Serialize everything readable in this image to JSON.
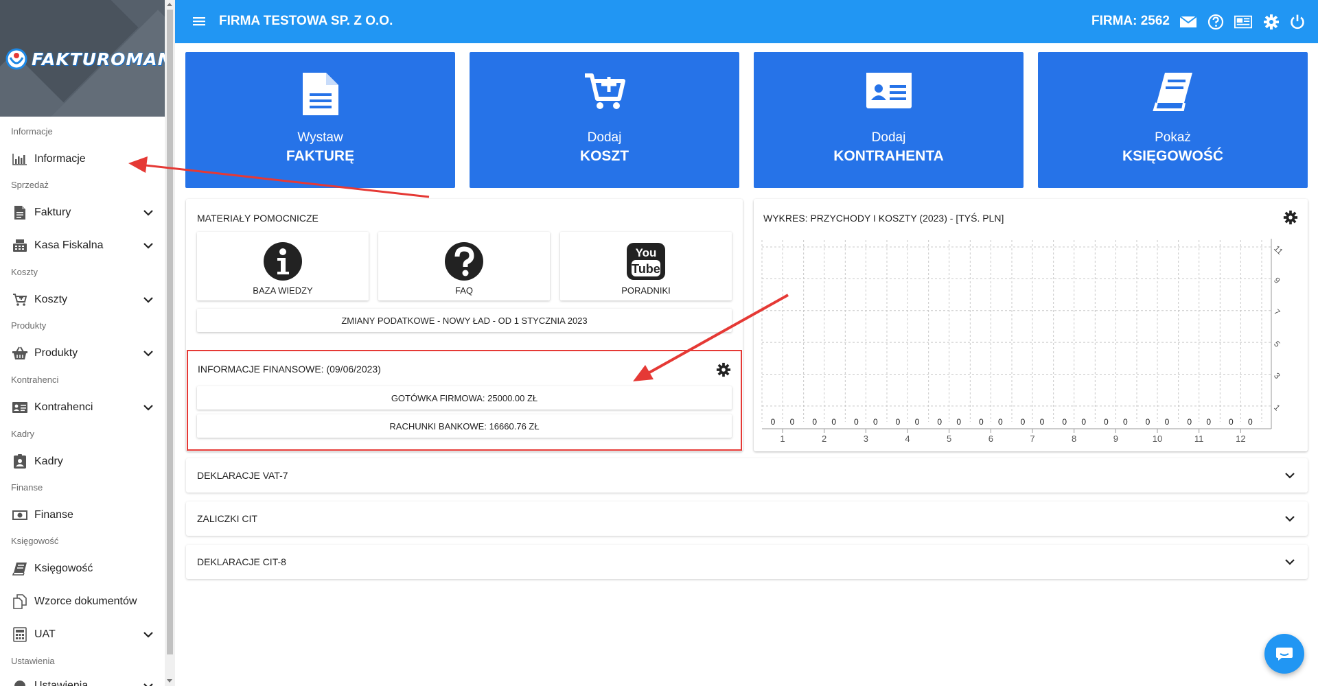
{
  "sidebar": {
    "logo_text": "FAKTUROMANIA",
    "sections": {
      "informacje": "Informacje",
      "sprzedaz": "Sprzedaż",
      "koszty": "Koszty",
      "produkty": "Produkty",
      "kontrahenci": "Kontrahenci",
      "kadry": "Kadry",
      "finanse": "Finanse",
      "ksiegowosc": "Księgowość",
      "ustawienia": "Ustawienia"
    },
    "items": {
      "informacje": "Informacje",
      "faktury": "Faktury",
      "kasa": "Kasa Fiskalna",
      "koszty": "Koszty",
      "produkty": "Produkty",
      "kontrahenci": "Kontrahenci",
      "kadry": "Kadry",
      "finanse": "Finanse",
      "ksiegowosc": "Księgowość",
      "wzorce": "Wzorce dokumentów",
      "uat": "UAT",
      "ustawienia": "Ustawienia"
    }
  },
  "header": {
    "company": "FIRMA TESTOWA SP. Z O.O.",
    "firma": "FIRMA: 2562",
    "icons": [
      "mail-icon",
      "help-icon",
      "news-icon",
      "gear-icon",
      "power-icon"
    ]
  },
  "tiles": [
    {
      "small": "Wystaw",
      "big": "FAKTURĘ",
      "icon": "document-icon"
    },
    {
      "small": "Dodaj",
      "big": "KOSZT",
      "icon": "cart-plus-icon"
    },
    {
      "small": "Dodaj",
      "big": "KONTRAHENTA",
      "icon": "id-card-icon"
    },
    {
      "small": "Pokaż",
      "big": "KSIĘGOWOŚĆ",
      "icon": "book-icon"
    }
  ],
  "materials": {
    "title": "MATERIAŁY POMOCNICZE",
    "items": [
      "BAZA WIEDZY",
      "FAQ",
      "PORADNIKI"
    ],
    "youtube_logo": [
      "You",
      "Tube"
    ],
    "news_button": "ZMIANY PODATKOWE - NOWY ŁAD - OD 1 STYCZNIA 2023"
  },
  "finance": {
    "title": "INFORMACJE FINANSOWE: (09/06/2023)",
    "cash": "GOTÓWKA FIRMOWA: 25000.00 ZŁ",
    "bank": "RACHUNKI BANKOWE: 16660.76 ZŁ"
  },
  "chart_title": "WYKRES: PRZYCHODY I KOSZTY (2023) - [TYŚ. PLN]",
  "chart_data": {
    "type": "bar",
    "title": "WYKRES: PRZYCHODY I KOSZTY (2023) - [TYŚ. PLN]",
    "categories": [
      "1",
      "2",
      "3",
      "4",
      "5",
      "6",
      "7",
      "8",
      "9",
      "10",
      "11",
      "12"
    ],
    "series": [
      {
        "values": [
          0,
          0,
          0,
          0,
          0,
          0,
          0,
          0,
          0,
          0,
          0,
          0
        ]
      },
      {
        "values": [
          0,
          0,
          0,
          0,
          0,
          0,
          0,
          0,
          0,
          0,
          0,
          0
        ]
      }
    ],
    "y_ticks": [
      "1",
      "3",
      "5",
      "7",
      "9",
      "11"
    ],
    "ylim": [
      0,
      11
    ],
    "grid": true
  },
  "accordions": [
    "DEKLARACJE VAT-7",
    "ZALICZKI CIT",
    "DEKLARACJE CIT-8"
  ],
  "colors": {
    "primary": "#2196f3",
    "tile": "#2673e8",
    "highlight": "#e53935"
  }
}
